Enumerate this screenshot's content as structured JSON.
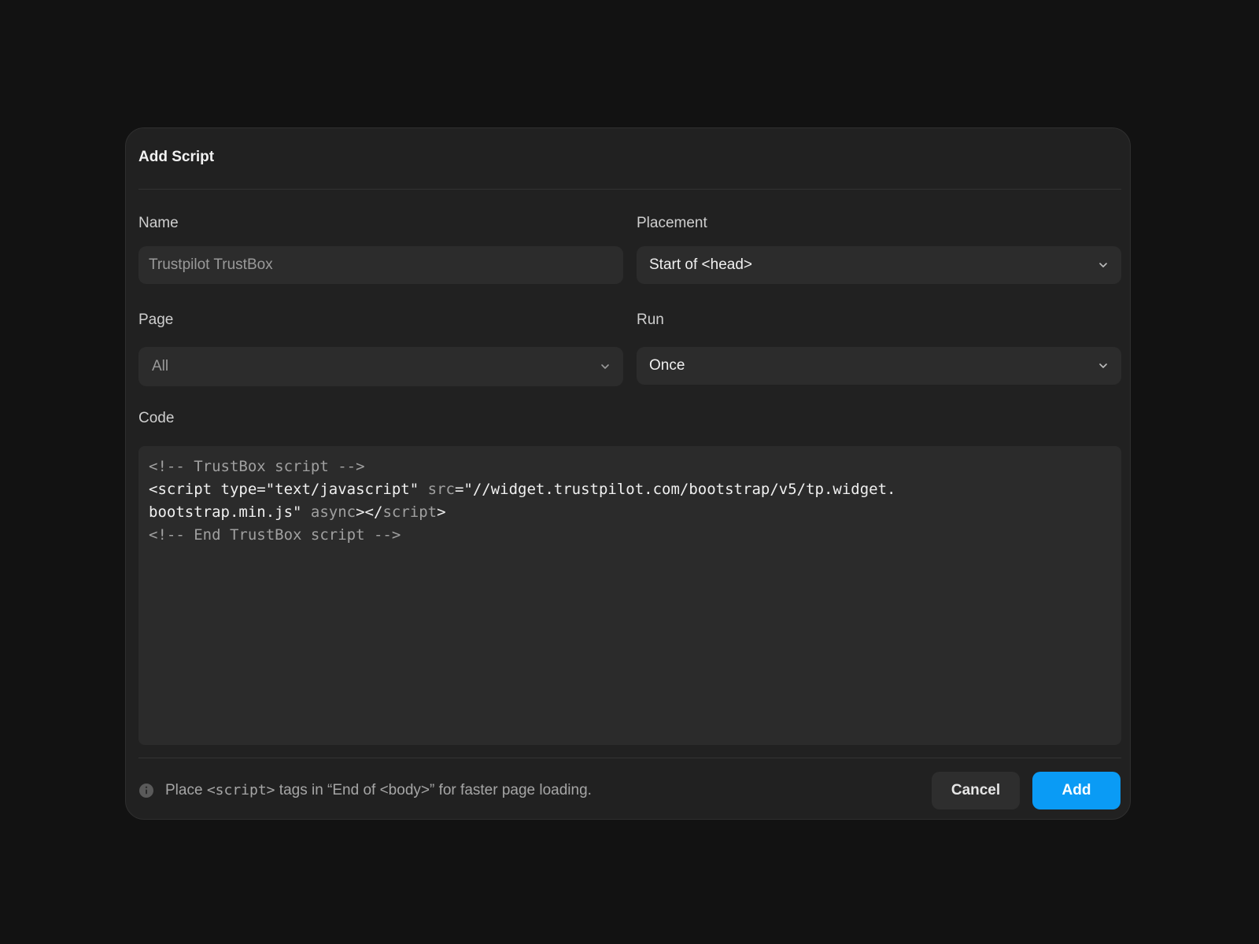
{
  "dialog": {
    "title": "Add Script"
  },
  "fields": {
    "name": {
      "label": "Name",
      "placeholder": "Trustpilot TrustBox"
    },
    "placement": {
      "label": "Placement",
      "value": "Start of <head>"
    },
    "page": {
      "label": "Page",
      "value": "All"
    },
    "run": {
      "label": "Run",
      "value": "Once"
    },
    "code": {
      "label": "Code",
      "lines": [
        {
          "segments": [
            {
              "text": "<!-- TrustBox script -->",
              "tone": "dim"
            }
          ]
        },
        {
          "segments": [
            {
              "text": "<script ",
              "tone": "bright"
            },
            {
              "text": "type",
              "tone": "bright"
            },
            {
              "text": "=\"text/javascript\" ",
              "tone": "bright"
            },
            {
              "text": "src",
              "tone": "dim"
            },
            {
              "text": "=\"//widget.trustpilot.com/bootstrap/v5/tp.widget.",
              "tone": "bright"
            }
          ]
        },
        {
          "segments": [
            {
              "text": "bootstrap.min.js\" ",
              "tone": "bright"
            },
            {
              "text": "async",
              "tone": "dim"
            },
            {
              "text": "></",
              "tone": "bright"
            },
            {
              "text": "script",
              "tone": "dim"
            },
            {
              "text": ">",
              "tone": "bright"
            }
          ]
        },
        {
          "segments": [
            {
              "text": "<!-- End TrustBox script -->",
              "tone": "dim"
            }
          ]
        }
      ]
    }
  },
  "footer": {
    "hint_before": "Place ",
    "hint_code": "<script>",
    "hint_after": " tags in “End of <body>” for faster page loading.",
    "cancel_label": "Cancel",
    "add_label": "Add"
  },
  "icons": {
    "info": "info-icon",
    "chevron": "chevron-down-icon"
  },
  "colors": {
    "background": "#121212",
    "dialog": "#212121",
    "field": "#2c2c2c",
    "accent": "#0a9bf5"
  }
}
